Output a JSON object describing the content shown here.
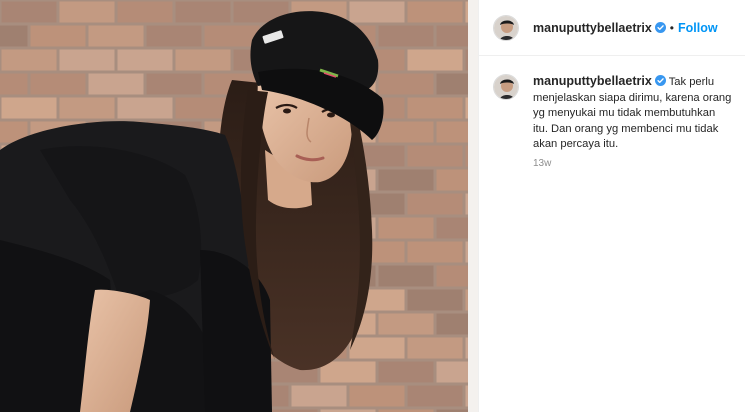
{
  "post": {
    "username": "manuputtybellaetrix",
    "separator": "•",
    "follow_label": "Follow",
    "caption": "Tak perlu menjelaskan siapa dirimu, karena orang yg menyukai mu tidak membutuhkan itu. Dan orang yg membenci mu tidak akan percaya itu.",
    "time_ago": "13w"
  },
  "colors": {
    "accent": "#0095f6",
    "text": "#262626",
    "muted": "#8e8e8e",
    "verified": "#3897f0"
  },
  "icons": {
    "verified": "verified-badge-icon"
  }
}
